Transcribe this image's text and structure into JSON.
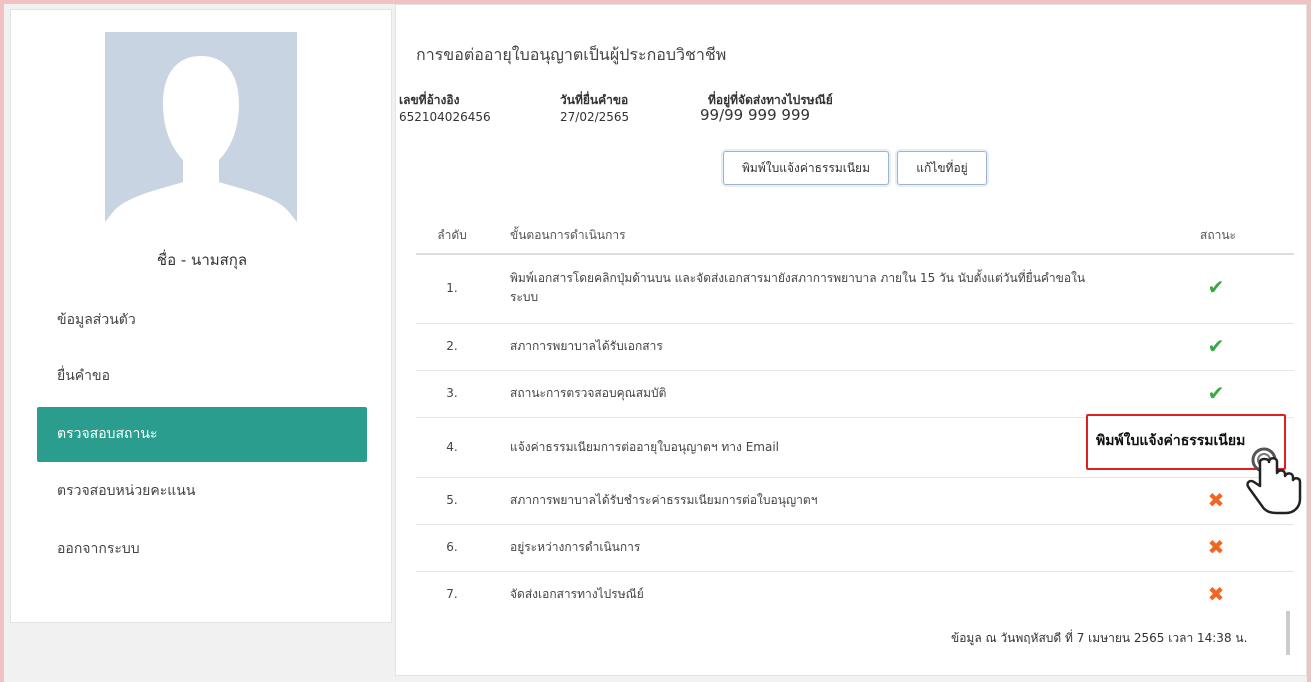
{
  "sidebar": {
    "user_name": "ชื่อ - นามสกุล",
    "menu": [
      {
        "label": "ข้อมูลส่วนตัว",
        "active": false
      },
      {
        "label": "ยื่นคำขอ",
        "active": false
      },
      {
        "label": "ตรวจสอบสถานะ",
        "active": true
      },
      {
        "label": "ตรวจสอบหน่วยคะแนน",
        "active": false
      },
      {
        "label": "ออกจากระบบ",
        "active": false
      }
    ]
  },
  "main": {
    "title": "การขอต่ออายุใบอนุญาตเป็นผู้ประกอบวิชาชีพ",
    "info": {
      "ref_label": "เลขที่อ้างอิง",
      "ref_value": "652104026456",
      "date_label": "วันที่ยื่นคำขอ",
      "date_value": "27/02/2565",
      "address_label": "ที่อยู่ที่จัดส่งทางไปรษณีย์",
      "address_value": "99/99 999 999"
    },
    "buttons": {
      "print_fee": "พิมพ์ใบแจ้งค่าธรรมเนียม",
      "edit_address": "แก้ไขที่อยู่"
    },
    "table": {
      "headers": {
        "no": "ลำดับ",
        "step": "ขั้นตอนการดำเนินการ",
        "status": "สถานะ"
      },
      "rows": [
        {
          "no": "1.",
          "step": "พิมพ์เอกสารโดยคลิกปุ่มด้านบน และจัดส่งเอกสารมายังสภาการพยาบาล ภายใน 15 วัน นับตั้งแต่วันที่ยื่นคำขอในระบบ",
          "status": "✔",
          "status_kind": "done"
        },
        {
          "no": "2.",
          "step": "สภาการพยาบาลได้รับเอกสาร",
          "status": "✔",
          "status_kind": "done"
        },
        {
          "no": "3.",
          "step": "สถานะการตรวจสอบคุณสมบัติ",
          "status": "✔",
          "status_kind": "done"
        },
        {
          "no": "4.",
          "step": "แจ้งค่าธรรมเนียมการต่ออายุใบอนุญาตฯ ทาง Email",
          "status": "",
          "status_kind": "action"
        },
        {
          "no": "5.",
          "step": "สภาการพยาบาลได้รับชำระค่าธรรมเนียมการต่อใบอนุญาตฯ",
          "status": "✖",
          "status_kind": "pending"
        },
        {
          "no": "6.",
          "step": "อยู่ระหว่างการดำเนินการ",
          "status": "✖",
          "status_kind": "pending"
        },
        {
          "no": "7.",
          "step": "จัดส่งเอกสารทางไปรษณีย์",
          "status": "✖",
          "status_kind": "pending"
        }
      ]
    },
    "footer_note": "ข้อมูล ณ วันพฤหัสบดี ที่ 7 เมษายน 2565 เวลา 14:38 น."
  },
  "callout": {
    "label": "พิมพ์ใบแจ้งค่าธรรมเนียม"
  },
  "colors": {
    "accent": "#2a9d8f",
    "check": "#3aa845",
    "cross": "#f26522",
    "callout_border": "#e02020"
  }
}
